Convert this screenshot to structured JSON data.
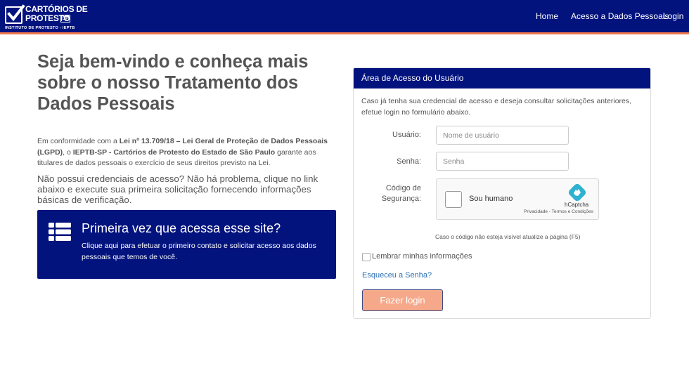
{
  "header": {
    "logo": {
      "line1": "CARTÓRIOS DE",
      "line2": "PROTESTO",
      "badge": "SP",
      "line3": "INSTITUTO DE PROTESTO - IEPTB"
    },
    "nav": {
      "home": "Home",
      "acesso": "Acesso a Dados Pessoais",
      "login": "Login"
    },
    "colors": {
      "bar": "#02137e",
      "accent": "#f2784b"
    }
  },
  "hero": {
    "title": "Seja bem-vindo e conheça mais sobre o nosso Tratamento dos Dados Pessoais",
    "intro_pre": "Em conformidade com a ",
    "intro_law": "Lei nº 13.709/18 – Lei Geral de Proteção de Dados Pessoais (LGPD)",
    "intro_mid": ", o ",
    "intro_org": "IEPTB-SP - Cartórios de Protesto do Estado de São Paulo",
    "intro_post": " garante aos titulares de dados pessoais o exercício de seus direitos previsto na Lei.",
    "noaccess": "Não possui credenciais de acesso? Não há problema, clique no link abaixo e execute sua primeira solicitação fornecendo informações básicas de verificação."
  },
  "first_access": {
    "icon": "list-icon",
    "title": "Primeira vez que acessa esse site?",
    "desc": "Clique aqui para efetuar o primeiro contato e solicitar acesso aos dados pessoais que temos de você."
  },
  "login_panel": {
    "title": "Área de Acesso do Usuário",
    "desc": "Caso já tenha sua credencial de acesso e deseja consultar solicitações anteriores, efetue login no formulário abaixo.",
    "user_label": "Usuário:",
    "user_placeholder": "Nome de usuário",
    "user_value": "",
    "pass_label": "Senha:",
    "pass_placeholder": "Senha",
    "pass_value": "",
    "captcha_label_1": "Código de",
    "captcha_label_2": "Segurança:",
    "captcha": {
      "checkbox_label": "Sou humano",
      "brand": "hCaptcha",
      "links": "Privacidade - Termos e Condições"
    },
    "captcha_note": "Caso o código não esteja visível atualize a página (F5)",
    "remember": "Lembrar minhas informações",
    "forgot": "Esqueceu a Senha?",
    "submit": "Fazer login"
  }
}
